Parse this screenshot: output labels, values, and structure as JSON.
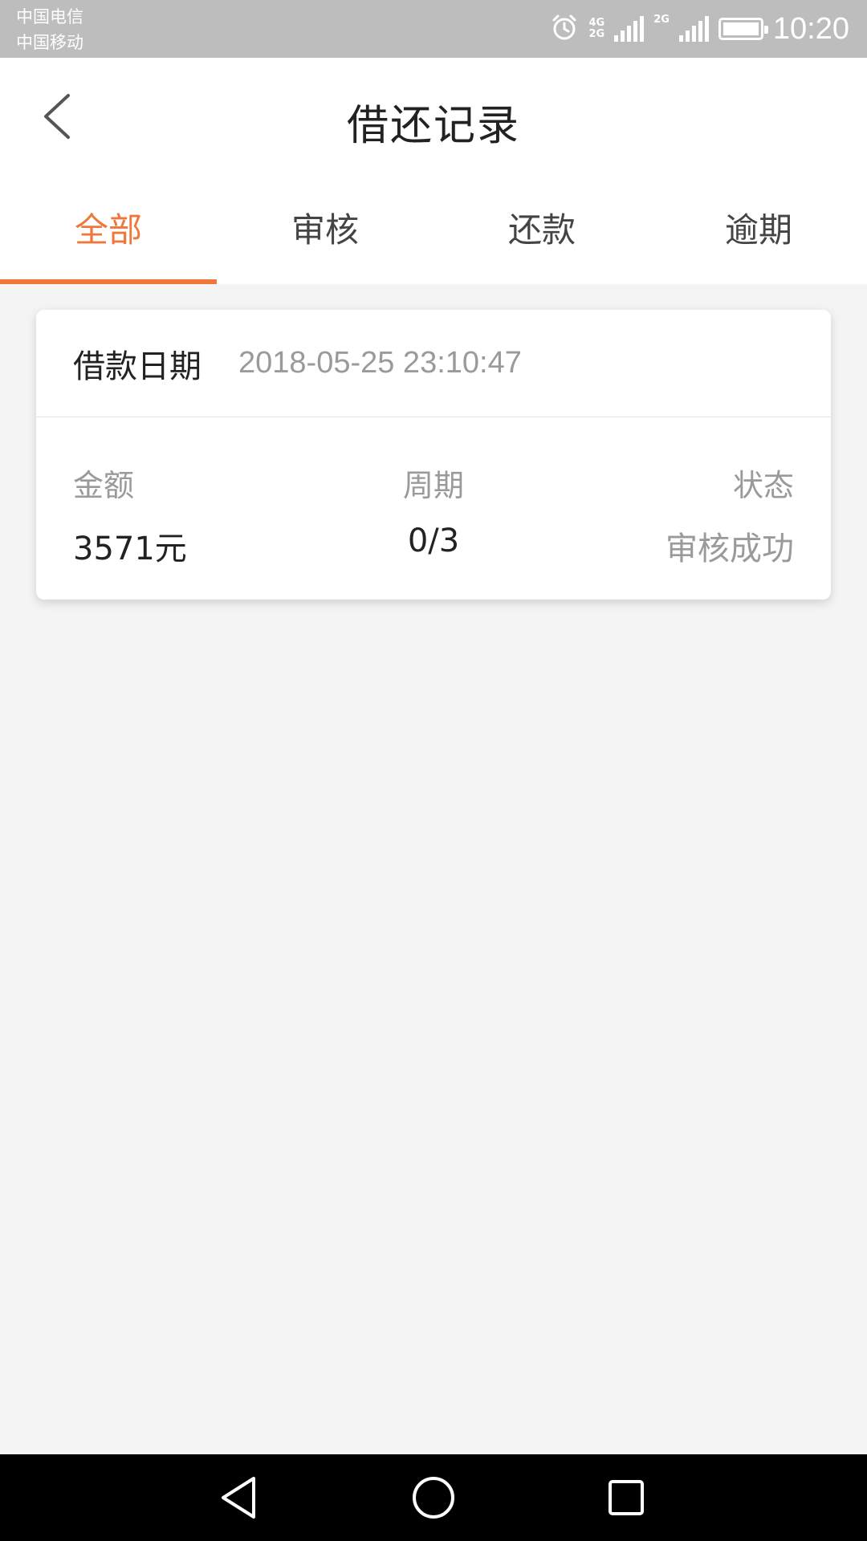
{
  "status_bar": {
    "carrier1": "中国电信",
    "carrier2": "中国移动",
    "network1": "4G",
    "network1b": "2G",
    "network2": "2G",
    "time": "10:20"
  },
  "header": {
    "title": "借还记录"
  },
  "tabs": [
    {
      "label": "全部",
      "active": true
    },
    {
      "label": "审核",
      "active": false
    },
    {
      "label": "还款",
      "active": false
    },
    {
      "label": "逾期",
      "active": false
    }
  ],
  "records": [
    {
      "date_label": "借款日期",
      "date_value": "2018-05-25 23:10:47",
      "amount_label": "金额",
      "amount_value": "3571元",
      "period_label": "周期",
      "period_value": "0/3",
      "status_label": "状态",
      "status_value": "审核成功"
    }
  ],
  "colors": {
    "accent": "#f0773c",
    "status_bar_bg": "#bdbdbd",
    "page_bg": "#f4f4f4"
  },
  "icons": {
    "back": "chevron-left-icon",
    "alarm": "alarm-icon",
    "battery": "battery-icon",
    "nav_back": "triangle-back-icon",
    "nav_home": "circle-home-icon",
    "nav_recent": "square-recent-icon"
  }
}
